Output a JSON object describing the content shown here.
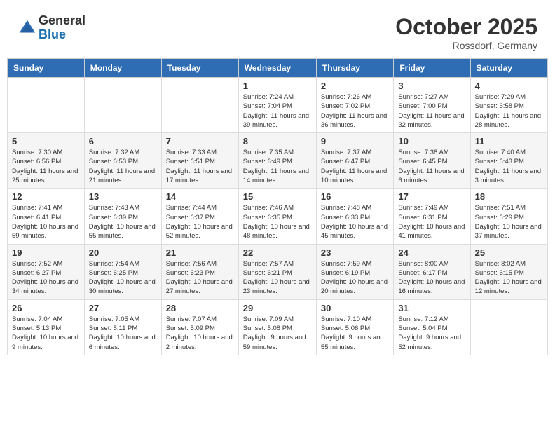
{
  "header": {
    "logo_general": "General",
    "logo_blue": "Blue",
    "month_title": "October 2025",
    "location": "Rossdorf, Germany"
  },
  "weekdays": [
    "Sunday",
    "Monday",
    "Tuesday",
    "Wednesday",
    "Thursday",
    "Friday",
    "Saturday"
  ],
  "weeks": [
    [
      {
        "day": "",
        "info": ""
      },
      {
        "day": "",
        "info": ""
      },
      {
        "day": "",
        "info": ""
      },
      {
        "day": "1",
        "info": "Sunrise: 7:24 AM\nSunset: 7:04 PM\nDaylight: 11 hours\nand 39 minutes."
      },
      {
        "day": "2",
        "info": "Sunrise: 7:26 AM\nSunset: 7:02 PM\nDaylight: 11 hours\nand 36 minutes."
      },
      {
        "day": "3",
        "info": "Sunrise: 7:27 AM\nSunset: 7:00 PM\nDaylight: 11 hours\nand 32 minutes."
      },
      {
        "day": "4",
        "info": "Sunrise: 7:29 AM\nSunset: 6:58 PM\nDaylight: 11 hours\nand 28 minutes."
      }
    ],
    [
      {
        "day": "5",
        "info": "Sunrise: 7:30 AM\nSunset: 6:56 PM\nDaylight: 11 hours\nand 25 minutes."
      },
      {
        "day": "6",
        "info": "Sunrise: 7:32 AM\nSunset: 6:53 PM\nDaylight: 11 hours\nand 21 minutes."
      },
      {
        "day": "7",
        "info": "Sunrise: 7:33 AM\nSunset: 6:51 PM\nDaylight: 11 hours\nand 17 minutes."
      },
      {
        "day": "8",
        "info": "Sunrise: 7:35 AM\nSunset: 6:49 PM\nDaylight: 11 hours\nand 14 minutes."
      },
      {
        "day": "9",
        "info": "Sunrise: 7:37 AM\nSunset: 6:47 PM\nDaylight: 11 hours\nand 10 minutes."
      },
      {
        "day": "10",
        "info": "Sunrise: 7:38 AM\nSunset: 6:45 PM\nDaylight: 11 hours\nand 6 minutes."
      },
      {
        "day": "11",
        "info": "Sunrise: 7:40 AM\nSunset: 6:43 PM\nDaylight: 11 hours\nand 3 minutes."
      }
    ],
    [
      {
        "day": "12",
        "info": "Sunrise: 7:41 AM\nSunset: 6:41 PM\nDaylight: 10 hours\nand 59 minutes."
      },
      {
        "day": "13",
        "info": "Sunrise: 7:43 AM\nSunset: 6:39 PM\nDaylight: 10 hours\nand 55 minutes."
      },
      {
        "day": "14",
        "info": "Sunrise: 7:44 AM\nSunset: 6:37 PM\nDaylight: 10 hours\nand 52 minutes."
      },
      {
        "day": "15",
        "info": "Sunrise: 7:46 AM\nSunset: 6:35 PM\nDaylight: 10 hours\nand 48 minutes."
      },
      {
        "day": "16",
        "info": "Sunrise: 7:48 AM\nSunset: 6:33 PM\nDaylight: 10 hours\nand 45 minutes."
      },
      {
        "day": "17",
        "info": "Sunrise: 7:49 AM\nSunset: 6:31 PM\nDaylight: 10 hours\nand 41 minutes."
      },
      {
        "day": "18",
        "info": "Sunrise: 7:51 AM\nSunset: 6:29 PM\nDaylight: 10 hours\nand 37 minutes."
      }
    ],
    [
      {
        "day": "19",
        "info": "Sunrise: 7:52 AM\nSunset: 6:27 PM\nDaylight: 10 hours\nand 34 minutes."
      },
      {
        "day": "20",
        "info": "Sunrise: 7:54 AM\nSunset: 6:25 PM\nDaylight: 10 hours\nand 30 minutes."
      },
      {
        "day": "21",
        "info": "Sunrise: 7:56 AM\nSunset: 6:23 PM\nDaylight: 10 hours\nand 27 minutes."
      },
      {
        "day": "22",
        "info": "Sunrise: 7:57 AM\nSunset: 6:21 PM\nDaylight: 10 hours\nand 23 minutes."
      },
      {
        "day": "23",
        "info": "Sunrise: 7:59 AM\nSunset: 6:19 PM\nDaylight: 10 hours\nand 20 minutes."
      },
      {
        "day": "24",
        "info": "Sunrise: 8:00 AM\nSunset: 6:17 PM\nDaylight: 10 hours\nand 16 minutes."
      },
      {
        "day": "25",
        "info": "Sunrise: 8:02 AM\nSunset: 6:15 PM\nDaylight: 10 hours\nand 12 minutes."
      }
    ],
    [
      {
        "day": "26",
        "info": "Sunrise: 7:04 AM\nSunset: 5:13 PM\nDaylight: 10 hours\nand 9 minutes."
      },
      {
        "day": "27",
        "info": "Sunrise: 7:05 AM\nSunset: 5:11 PM\nDaylight: 10 hours\nand 6 minutes."
      },
      {
        "day": "28",
        "info": "Sunrise: 7:07 AM\nSunset: 5:09 PM\nDaylight: 10 hours\nand 2 minutes."
      },
      {
        "day": "29",
        "info": "Sunrise: 7:09 AM\nSunset: 5:08 PM\nDaylight: 9 hours\nand 59 minutes."
      },
      {
        "day": "30",
        "info": "Sunrise: 7:10 AM\nSunset: 5:06 PM\nDaylight: 9 hours\nand 55 minutes."
      },
      {
        "day": "31",
        "info": "Sunrise: 7:12 AM\nSunset: 5:04 PM\nDaylight: 9 hours\nand 52 minutes."
      },
      {
        "day": "",
        "info": ""
      }
    ]
  ]
}
